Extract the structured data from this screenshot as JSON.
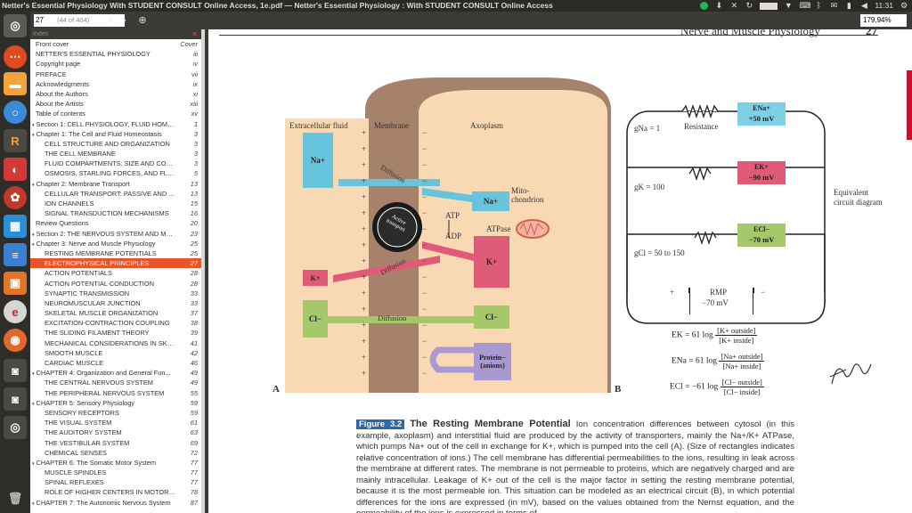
{
  "window": {
    "title": "Netter's Essential Physiology With STUDENT CONSULT Online Access, 1e.pdf — Netter's Essential Physiology : With STUDENT CONSULT Online Access"
  },
  "tray": {
    "clock": "11:31"
  },
  "toolbar": {
    "page_value": "27",
    "page_count": "(44 of 404)",
    "prev": "‹",
    "next": "›",
    "zoom": "179,94%"
  },
  "index": {
    "header": "Index",
    "items": [
      {
        "label": "Front cover",
        "page": "Cover",
        "level": 0,
        "tri": ""
      },
      {
        "label": "NETTER'S ESSENTIAL PHYSIOLOGY",
        "page": "iii",
        "level": 0,
        "tri": ""
      },
      {
        "label": "Copyright page",
        "page": "iv",
        "level": 0,
        "tri": ""
      },
      {
        "label": "PREFACE",
        "page": "vii",
        "level": 0,
        "tri": ""
      },
      {
        "label": "Acknowledgments",
        "page": "ix",
        "level": 0,
        "tri": ""
      },
      {
        "label": "About the Authors",
        "page": "xi",
        "level": 0,
        "tri": ""
      },
      {
        "label": "About the Artists",
        "page": "xiii",
        "level": 0,
        "tri": ""
      },
      {
        "label": "Table of contents",
        "page": "xv",
        "level": 0,
        "tri": ""
      },
      {
        "label": "Section 1: CELL PHYSIOLOGY, FLUID HOME...",
        "page": "1",
        "level": 0,
        "tri": "▾"
      },
      {
        "label": "Chapter 1: The Cell and Fluid Homeostasis",
        "page": "3",
        "level": 1,
        "tri": "▾"
      },
      {
        "label": "CELL STRUCTURE AND ORGANIZATION",
        "page": "3",
        "level": 2,
        "tri": ""
      },
      {
        "label": "THE CELL MEMBRANE",
        "page": "3",
        "level": 2,
        "tri": ""
      },
      {
        "label": "FLUID COMPARTMENTS: SIZE AND CONS...",
        "page": "3",
        "level": 2,
        "tri": ""
      },
      {
        "label": "OSMOSIS, STARLING FORCES, AND FLUI...",
        "page": "5",
        "level": 2,
        "tri": ""
      },
      {
        "label": "Chapter 2: Membrane Transport",
        "page": "13",
        "level": 1,
        "tri": "▾"
      },
      {
        "label": "CELLULAR TRANSPORT: PASSIVE AND A...",
        "page": "13",
        "level": 2,
        "tri": ""
      },
      {
        "label": "ION CHANNELS",
        "page": "15",
        "level": 2,
        "tri": ""
      },
      {
        "label": "SIGNAL TRANSDUCTION MECHANISMS",
        "page": "16",
        "level": 2,
        "tri": ""
      },
      {
        "label": "Review Questions",
        "page": "20",
        "level": 1,
        "tri": ""
      },
      {
        "label": "Section 2: THE NERVOUS SYSTEM AND MUS...",
        "page": "23",
        "level": 0,
        "tri": "▾"
      },
      {
        "label": "Chapter 3: Nerve and Muscle Physiology",
        "page": "25",
        "level": 1,
        "tri": "▾"
      },
      {
        "label": "RESTING MEMBRANE POTENTIALS",
        "page": "25",
        "level": 2,
        "tri": ""
      },
      {
        "label": "ELECTROPHYSICAL PRINCIPLES",
        "page": "27",
        "level": 2,
        "tri": "",
        "selected": true
      },
      {
        "label": "ACTION POTENTIALS",
        "page": "28",
        "level": 2,
        "tri": ""
      },
      {
        "label": "ACTION POTENTIAL CONDUCTION",
        "page": "28",
        "level": 2,
        "tri": ""
      },
      {
        "label": "SYNAPTIC TRANSMISSION",
        "page": "33",
        "level": 2,
        "tri": ""
      },
      {
        "label": "NEUROMUSCULAR JUNCTION",
        "page": "33",
        "level": 2,
        "tri": ""
      },
      {
        "label": "SKELETAL MUSCLE ORGANIZATION",
        "page": "37",
        "level": 2,
        "tri": ""
      },
      {
        "label": "EXCITATION-CONTRACTION COUPLING",
        "page": "38",
        "level": 2,
        "tri": ""
      },
      {
        "label": "THE SLIDING FILAMENT THEORY",
        "page": "39",
        "level": 2,
        "tri": ""
      },
      {
        "label": "MECHANICAL CONSIDERATIONS IN SKEL...",
        "page": "41",
        "level": 2,
        "tri": ""
      },
      {
        "label": "SMOOTH MUSCLE",
        "page": "42",
        "level": 2,
        "tri": ""
      },
      {
        "label": "CARDIAC MUSCLE",
        "page": "46",
        "level": 2,
        "tri": ""
      },
      {
        "label": "CHAPTER 4: Organization and General Fun...",
        "page": "49",
        "level": 1,
        "tri": "▾"
      },
      {
        "label": "THE CENTRAL NERVOUS SYSTEM",
        "page": "49",
        "level": 2,
        "tri": ""
      },
      {
        "label": "THE PERIPHERAL NERVOUS SYSTEM",
        "page": "55",
        "level": 2,
        "tri": ""
      },
      {
        "label": "CHAPTER 5: Sensory Physiology",
        "page": "59",
        "level": 1,
        "tri": "▾"
      },
      {
        "label": "SENSORY RECEPTORS",
        "page": "59",
        "level": 2,
        "tri": ""
      },
      {
        "label": "THE VISUAL SYSTEM",
        "page": "61",
        "level": 2,
        "tri": ""
      },
      {
        "label": "THE AUDITORY SYSTEM",
        "page": "63",
        "level": 2,
        "tri": ""
      },
      {
        "label": "THE VESTIBULAR SYSTEM",
        "page": "69",
        "level": 2,
        "tri": ""
      },
      {
        "label": "CHEMICAL SENSES",
        "page": "72",
        "level": 2,
        "tri": ""
      },
      {
        "label": "CHAPTER 6: The Somatic Motor System",
        "page": "77",
        "level": 1,
        "tri": "▾"
      },
      {
        "label": "MUSCLE SPINDLES",
        "page": "77",
        "level": 2,
        "tri": ""
      },
      {
        "label": "SPINAL REFLEXES",
        "page": "77",
        "level": 2,
        "tri": ""
      },
      {
        "label": "ROLE OF HIGHER CENTERS IN MOTOR CO...",
        "page": "78",
        "level": 2,
        "tri": ""
      },
      {
        "label": "CHAPTER 7: The Autonomic Nervous System",
        "page": "87",
        "level": 1,
        "tri": "▾"
      }
    ]
  },
  "page": {
    "header_text": "Nerve and Muscle Physiology",
    "header_page": "27",
    "figure": {
      "extracellular": "Extracellular fluid",
      "membrane": "Membrane",
      "axoplasm": "Axoplasm",
      "na_out": "Na+",
      "na_in": "Na+",
      "k_out": "K+",
      "k_in": "K+",
      "cl_out": "Cl−",
      "cl_in": "Cl−",
      "protein": "Protein− (anions)",
      "diffusion1": "Diffusion",
      "diffusion2": "Diffusion",
      "diffusion3": "Diffusion",
      "active": "Active transport",
      "atp": "ATP",
      "adp": "ADP",
      "atpase": "ATPase",
      "mito": "Mito-chondrion",
      "label_a": "A",
      "label_b": "B",
      "gna": "gNa = 1",
      "gk": "gK = 100",
      "gcl": "gCl = 50 to 150",
      "resistance": "Resistance",
      "ena_name": "ENa+",
      "ena_val": "+50 mV",
      "ek_name": "EK+",
      "ek_val": "−90 mV",
      "ecl_name": "ECl−",
      "ecl_val": "−70 mV",
      "rmp": "RMP",
      "rmp_val": "−70 mV",
      "equiv": "Equivalent circuit diagram",
      "plus": "+",
      "minus": "−",
      "eq_k": "EK = 61 log",
      "eq_k_num": "[K+ outside]",
      "eq_k_den": "[K+ inside]",
      "eq_na": "ENa = 61 log",
      "eq_na_num": "[Na+ outside]",
      "eq_na_den": "[Na+ inside]",
      "eq_cl": "ECl = −61 log",
      "eq_cl_num": "[Cl− outside]",
      "eq_cl_den": "[Cl− inside]"
    },
    "caption": {
      "tag": "Figure 3.2",
      "title": "The Resting Membrane Potential",
      "body": "Ion concentration differences between cytosol (in this example, axoplasm) and interstitial fluid are produced by the activity of transporters, mainly the Na+/K+ ATPase, which pumps Na+ out of the cell in exchange for K+, which is pumped into the cell (A). (Size of rectangles indicates relative concentration of ions.) The cell membrane has differential permeabilities to the ions, resulting in leak across the membrane at different rates. The membrane is not permeable to proteins, which are negatively charged and are mainly intracellular. Leakage of K+ out of the cell is the major factor in setting the resting membrane potential, because it is the most permeable ion. This situation can be modeled as an electrical circuit (B), in which potential differences for the ions are expressed (in mV), based on the values obtained from the Nernst equation, and the permeability of the ions is expressed in terms of"
    }
  }
}
